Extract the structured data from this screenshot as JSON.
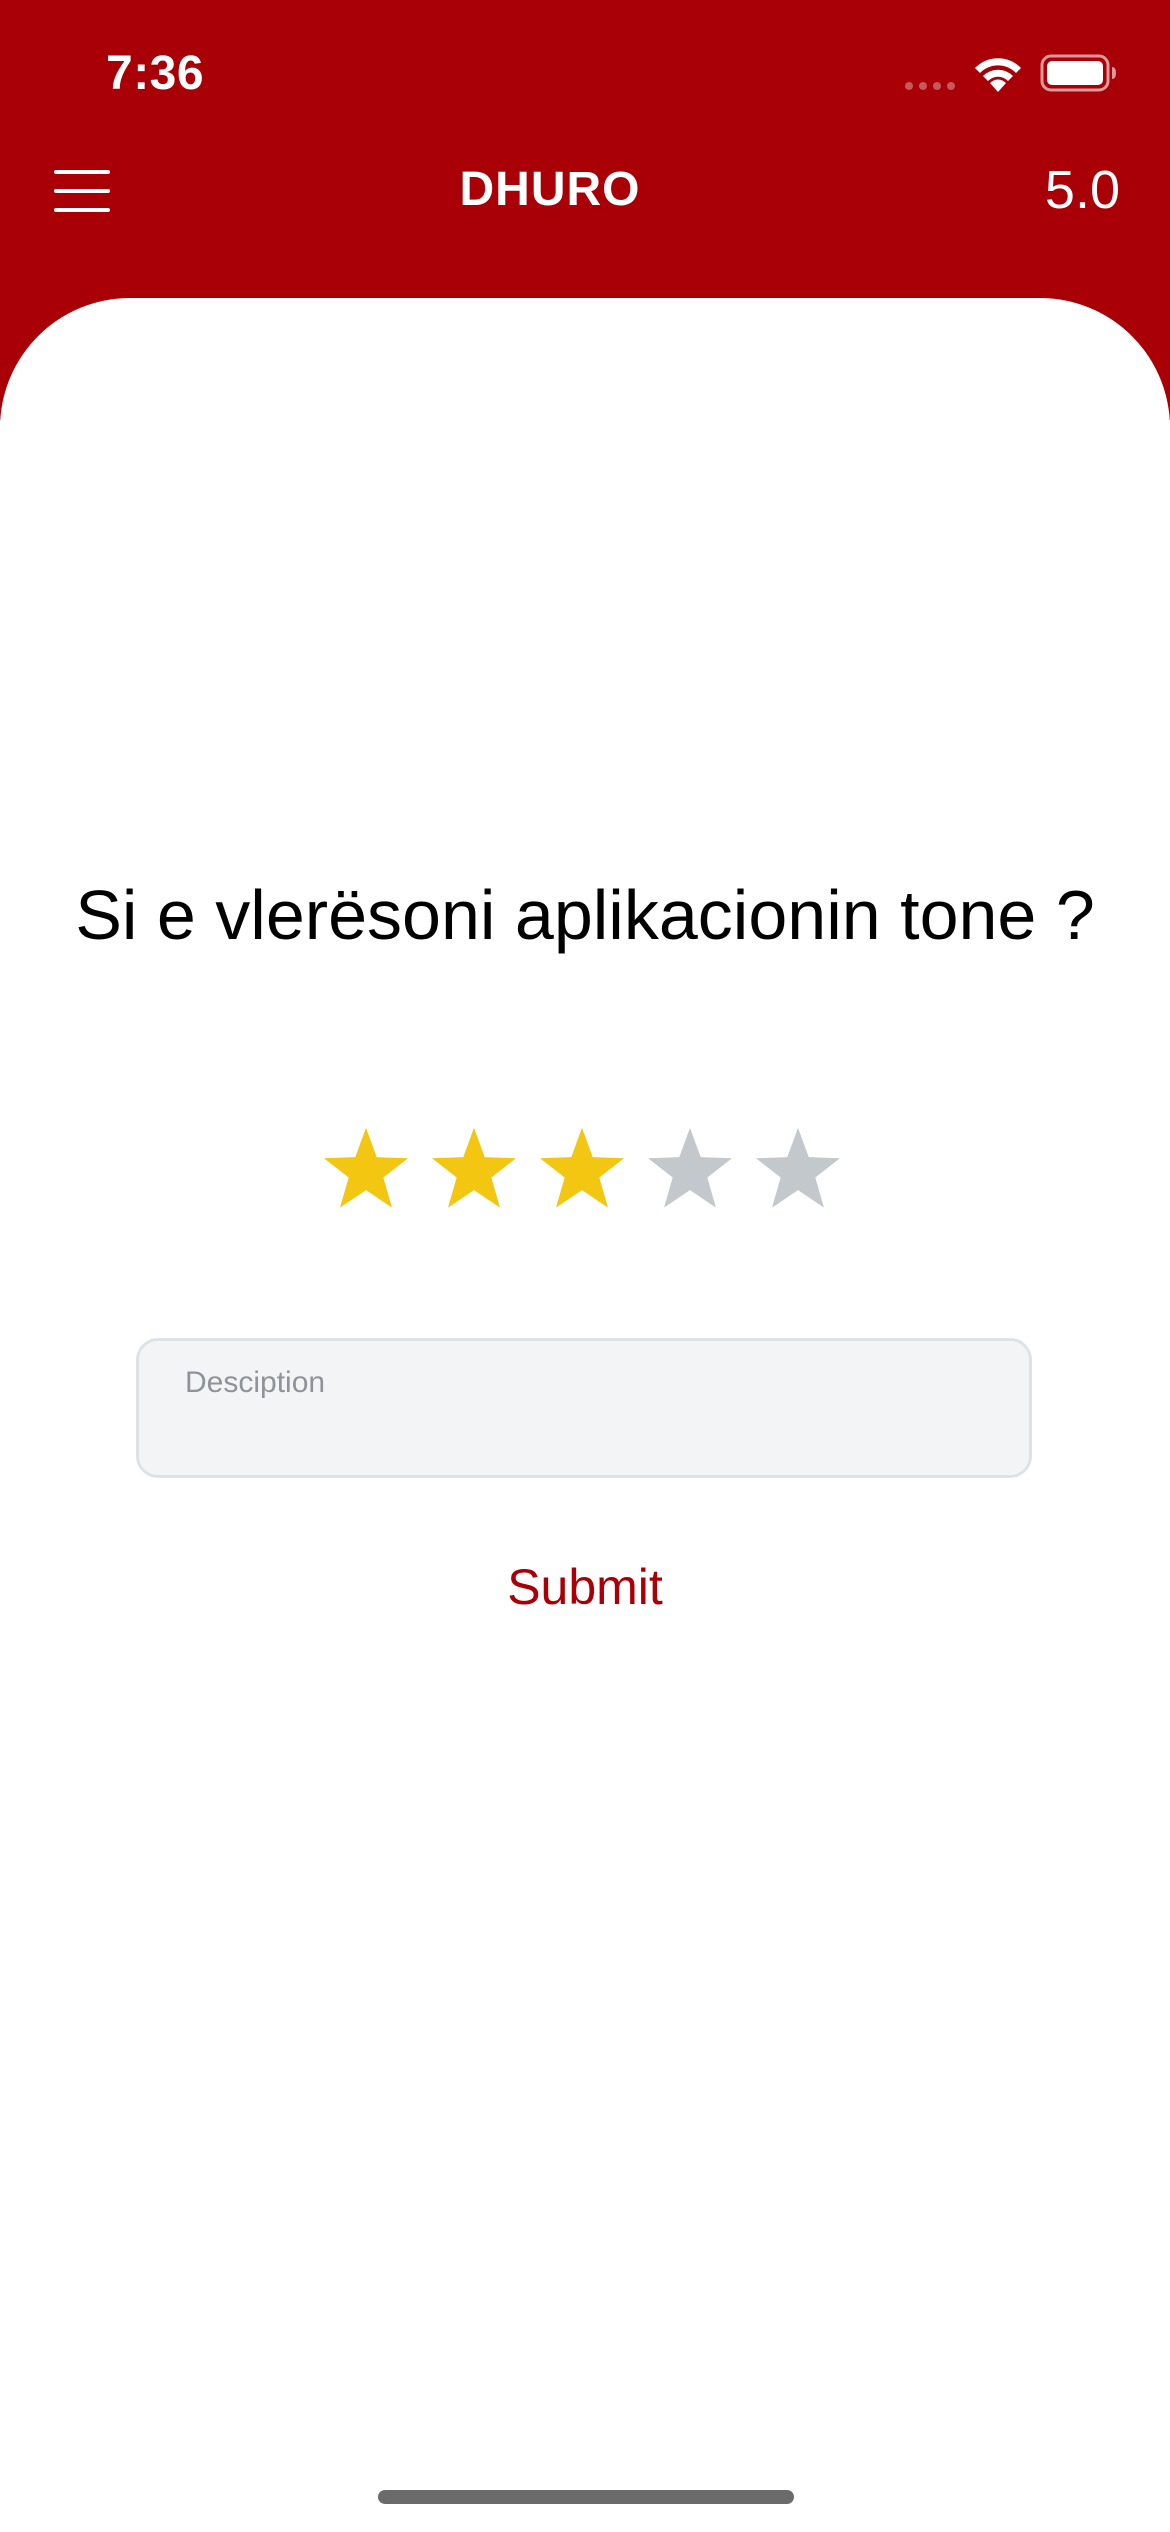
{
  "status_bar": {
    "time": "7:36"
  },
  "header": {
    "title": "DHURO",
    "version": "5.0",
    "background_color": "#A80006",
    "menu_icon": "hamburger-menu-icon"
  },
  "rating": {
    "question": "Si e vlerësoni aplikacionin tone ?",
    "value": 3,
    "max": 5,
    "filled_color": "#F2C611",
    "empty_color": "#C3C8CC"
  },
  "description": {
    "label": "Desciption",
    "value": ""
  },
  "submit": {
    "label": "Submit",
    "color": "#A80006"
  }
}
